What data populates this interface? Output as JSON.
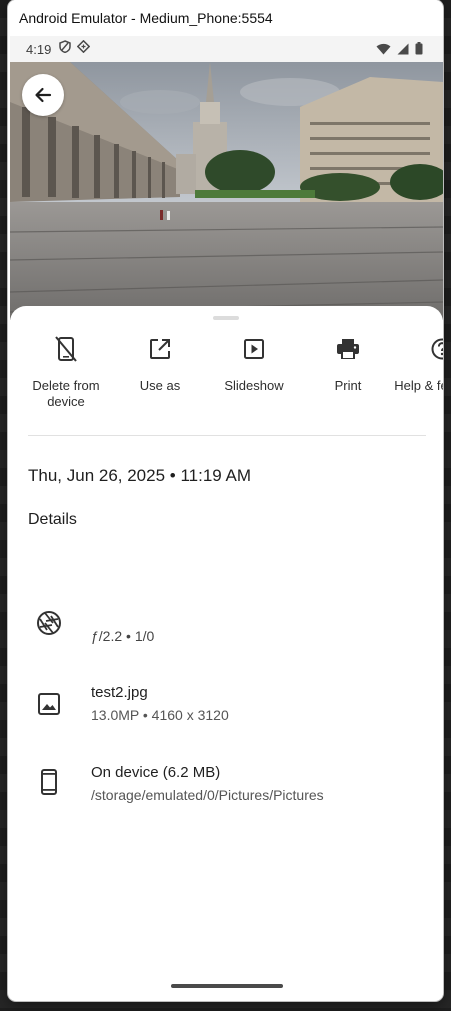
{
  "window": {
    "title": "Android Emulator - Medium_Phone:5554"
  },
  "status_bar": {
    "time": "4:19",
    "left_icons": [
      "shield-icon",
      "vpn-diamond-icon"
    ],
    "right_icons": [
      "wifi-icon",
      "signal-icon",
      "battery-icon"
    ]
  },
  "photo": {
    "alt_icon": "building-photo"
  },
  "actions": [
    {
      "label": "Delete from device",
      "icon": "delete-device-icon"
    },
    {
      "label": "Use as",
      "icon": "open-external-icon"
    },
    {
      "label": "Slideshow",
      "icon": "slideshow-icon"
    },
    {
      "label": "Print",
      "icon": "print-icon"
    },
    {
      "label": "Help & feedback",
      "icon": "help-icon"
    }
  ],
  "date": "Thu, Jun 26, 2025 • 11:19 AM",
  "details": {
    "heading": "Details",
    "camera": {
      "line2": "ƒ/2.2  •  1/0"
    },
    "file": {
      "name": "test2.jpg",
      "meta": "13.0MP  •  4160 x 3120"
    },
    "storage": {
      "title": "On device (6.2 MB)",
      "path": "/storage/emulated/0/Pictures/Pictures"
    }
  }
}
